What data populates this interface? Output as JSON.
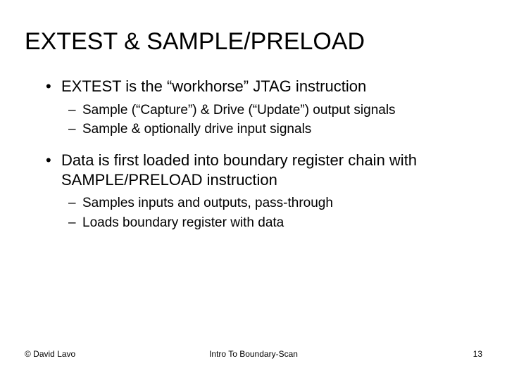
{
  "title": "EXTEST & SAMPLE/PRELOAD",
  "bullets": {
    "b1": "EXTEST is the “workhorse” JTAG instruction",
    "b1s1": "Sample (“Capture”) & Drive (“Update”) output signals",
    "b1s2": "Sample & optionally drive input signals",
    "b2": "Data is first loaded into boundary register chain with SAMPLE/PRELOAD instruction",
    "b2s1": "Samples inputs and outputs, pass-through",
    "b2s2": "Loads boundary register with data"
  },
  "footer": {
    "left": "© David Lavo",
    "center": "Intro To Boundary-Scan",
    "right": "13"
  }
}
